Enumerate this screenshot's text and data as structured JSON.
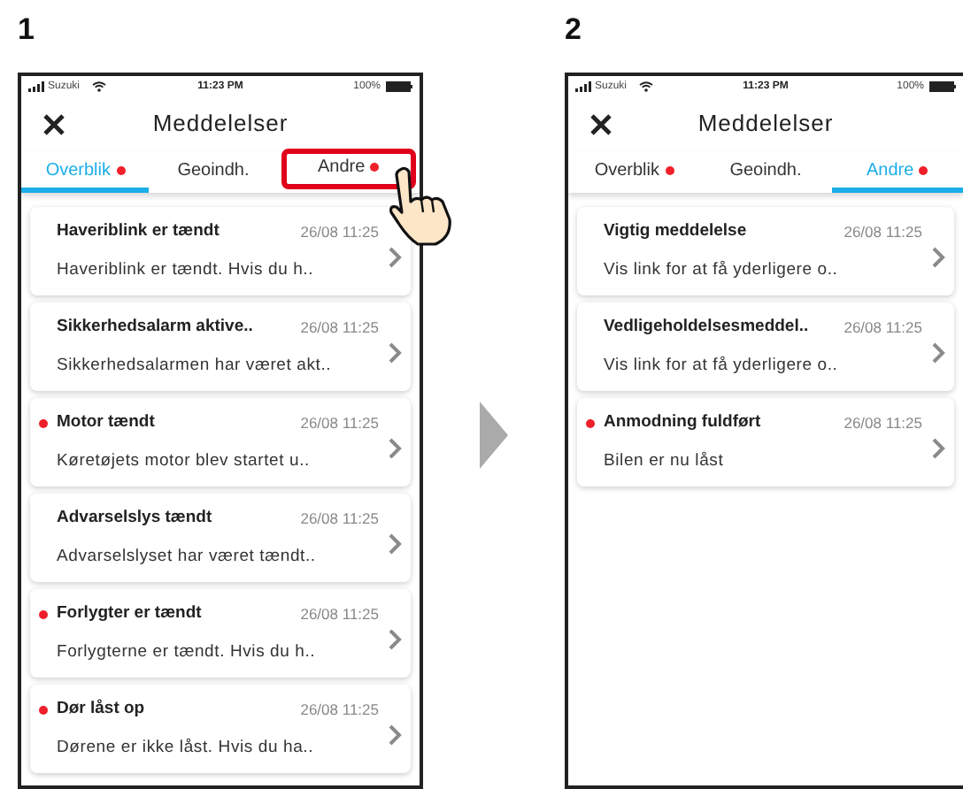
{
  "steps": [
    {
      "number": "1",
      "tap_hint": true,
      "screen": {
        "status": {
          "carrier": "Suzuki",
          "time": "11:23 PM",
          "battery": "100%"
        },
        "title": "Meddelelser",
        "tabs": [
          {
            "label": "Overblik",
            "selected": true,
            "unread": true,
            "highlighted": false
          },
          {
            "label": "Geoindh.",
            "selected": false,
            "unread": false,
            "highlighted": false
          },
          {
            "label": "Andre",
            "selected": false,
            "unread": true,
            "highlighted": true
          }
        ],
        "messages": [
          {
            "title": "Haveriblink er tændt",
            "time": "26/08 11:25",
            "preview": "Haveriblink er tændt. Hvis du h..",
            "unread": false
          },
          {
            "title": "Sikkerhedsalarm aktive..",
            "time": "26/08 11:25",
            "preview": "Sikkerhedsalarmen har været akt..",
            "unread": false
          },
          {
            "title": "Motor tændt",
            "time": "26/08 11:25",
            "preview": "Køretøjets motor blev startet u..",
            "unread": true
          },
          {
            "title": "Advarselslys tændt",
            "time": "26/08 11:25",
            "preview": "Advarselslyset har været tændt..",
            "unread": false
          },
          {
            "title": "Forlygter er tændt",
            "time": "26/08 11:25",
            "preview": "Forlygterne er tændt. Hvis du h..",
            "unread": true
          },
          {
            "title": "Dør låst op",
            "time": "26/08 11:25",
            "preview": "Dørene er ikke låst. Hvis du ha..",
            "unread": true
          }
        ]
      }
    },
    {
      "number": "2",
      "tap_hint": false,
      "screen": {
        "status": {
          "carrier": "Suzuki",
          "time": "11:23 PM",
          "battery": "100%"
        },
        "title": "Meddelelser",
        "tabs": [
          {
            "label": "Overblik",
            "selected": false,
            "unread": true,
            "highlighted": false
          },
          {
            "label": "Geoindh.",
            "selected": false,
            "unread": false,
            "highlighted": false
          },
          {
            "label": "Andre",
            "selected": true,
            "unread": true,
            "highlighted": false
          }
        ],
        "messages": [
          {
            "title": "Vigtig meddelelse",
            "time": "26/08 11:25",
            "preview": "Vis link for at få yderligere o..",
            "unread": false
          },
          {
            "title": "Vedligeholdelsesmeddel..",
            "time": "26/08 11:25",
            "preview": "Vis link for at få yderligere o..",
            "unread": false
          },
          {
            "title": "Anmodning fuldført",
            "time": "26/08 11:25",
            "preview": "Bilen er nu låst",
            "unread": true
          }
        ]
      }
    }
  ]
}
